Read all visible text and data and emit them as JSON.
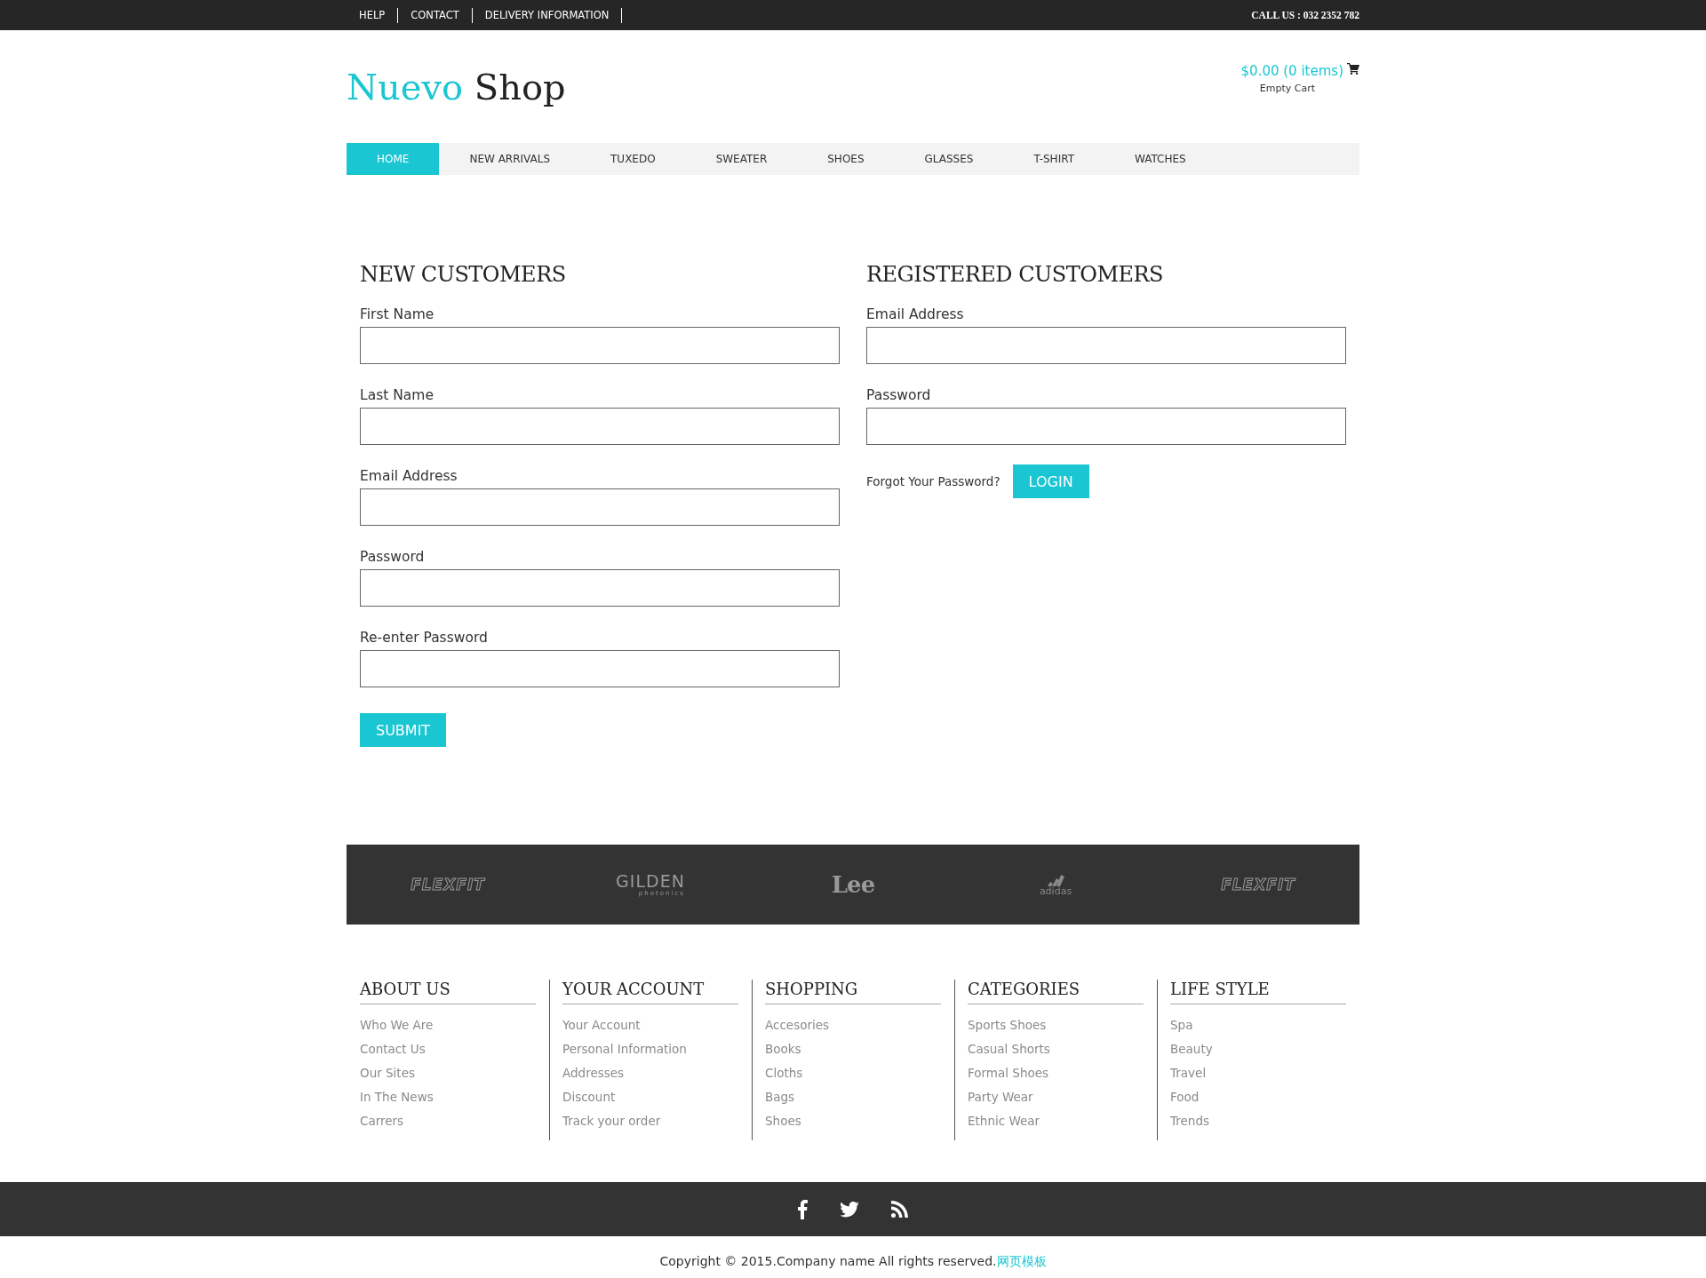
{
  "top_bar": {
    "links": [
      "HELP",
      "CONTACT",
      "DELIVERY INFORMATION"
    ],
    "phone": "CALL US : 032 2352 782"
  },
  "header": {
    "logo_part1": "Nuevo",
    "logo_part2": "Shop",
    "cart_total": "$0.00 (0 items)",
    "cart_action": "Empty Cart"
  },
  "nav": [
    {
      "label": "HOME",
      "selected": true
    },
    {
      "label": "NEW ARRIVALS",
      "selected": false
    },
    {
      "label": "TUXEDO",
      "selected": false
    },
    {
      "label": "SWEATER",
      "selected": false
    },
    {
      "label": "SHOES",
      "selected": false
    },
    {
      "label": "GLASSES",
      "selected": false
    },
    {
      "label": "T-SHIRT",
      "selected": false
    },
    {
      "label": "WATCHES",
      "selected": false
    }
  ],
  "new_customers": {
    "title": "NEW CUSTOMERS",
    "fields": [
      {
        "label": "First Name"
      },
      {
        "label": "Last Name"
      },
      {
        "label": "Email Address"
      },
      {
        "label": "Password"
      },
      {
        "label": "Re-enter Password"
      }
    ],
    "submit": "SUBMIT"
  },
  "registered_customers": {
    "title": "REGISTERED CUSTOMERS",
    "fields": [
      {
        "label": "Email Address"
      },
      {
        "label": "Password"
      }
    ],
    "forgot": "Forgot Your Password?",
    "login": "LOGIN"
  },
  "brands": [
    {
      "kind": "flexfit",
      "name": "FLEXFIT"
    },
    {
      "kind": "gilden",
      "name": "GILDEN",
      "sub": "photonics"
    },
    {
      "kind": "lee",
      "name": "Lee"
    },
    {
      "kind": "adidas",
      "name": "adidas"
    },
    {
      "kind": "flexfit",
      "name": "FLEXFIT"
    }
  ],
  "footer_columns": [
    {
      "title": "ABOUT US",
      "links": [
        "Who We Are",
        "Contact Us",
        "Our Sites",
        "In The News",
        "Carrers"
      ]
    },
    {
      "title": "YOUR ACCOUNT",
      "links": [
        "Your Account",
        "Personal Information",
        "Addresses",
        "Discount",
        "Track your order"
      ]
    },
    {
      "title": "SHOPPING",
      "links": [
        "Accesories",
        "Books",
        "Cloths",
        "Bags",
        "Shoes"
      ]
    },
    {
      "title": "CATEGORIES",
      "links": [
        "Sports Shoes",
        "Casual Shorts",
        "Formal Shoes",
        "Party Wear",
        "Ethnic Wear"
      ]
    },
    {
      "title": "LIFE STYLE",
      "links": [
        "Spa",
        "Beauty",
        "Travel",
        "Food",
        "Trends"
      ]
    }
  ],
  "social": [
    {
      "kind": "facebook"
    },
    {
      "kind": "twitter"
    },
    {
      "kind": "rss"
    }
  ],
  "copyright": {
    "text": "Copyright © 2015.Company name All rights reserved.",
    "link": "网页模板"
  }
}
